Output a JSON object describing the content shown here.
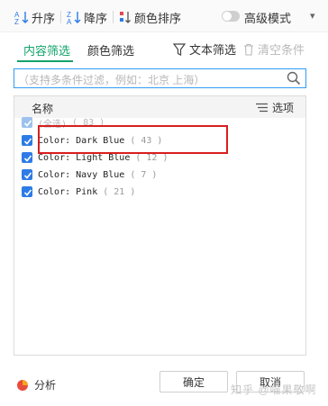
{
  "toolbar": {
    "sort_asc": "升序",
    "sort_desc": "降序",
    "color_sort": "颜色排序",
    "advanced_mode": "高级模式"
  },
  "tabs": [
    {
      "label": "内容筛选",
      "active": true
    },
    {
      "label": "颜色筛选",
      "active": false
    }
  ],
  "actions": {
    "text_filter": "文本筛选",
    "clear_condition": "清空条件"
  },
  "search": {
    "placeholder": "（支持多条件过滤，例如：北京 上海）"
  },
  "list": {
    "header_name": "名称",
    "options_label": "选项",
    "items": [
      {
        "name": "(全选)",
        "count": "( 83 )",
        "checked": true
      },
      {
        "name": "Color: Dark Blue",
        "count": "( 43 )",
        "checked": true
      },
      {
        "name": "Color: Light Blue",
        "count": "( 12 )",
        "checked": true
      },
      {
        "name": "Color: Navy Blue",
        "count": "( 7 )",
        "checked": true
      },
      {
        "name": "Color: Pink",
        "count": "( 21 )",
        "checked": true
      }
    ]
  },
  "footer": {
    "analyze": "分析",
    "ok": "确定",
    "cancel": "取消"
  },
  "watermark": "知乎 @喵果敬啊",
  "colors": {
    "accent_green": "#13a36b",
    "checkbox_blue": "#2d7be6",
    "highlight_red": "#d81e1e",
    "search_border": "#2e9cf4"
  }
}
